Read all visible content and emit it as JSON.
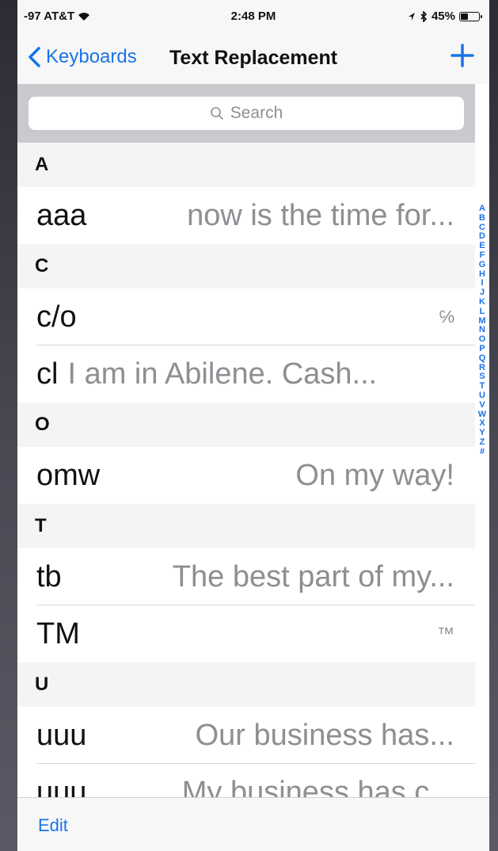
{
  "status_bar": {
    "carrier": "-97 AT&T",
    "time": "2:48 PM",
    "battery": "45%",
    "battery_level": 0.45
  },
  "nav": {
    "back_label": "Keyboards",
    "title": "Text Replacement"
  },
  "search": {
    "placeholder": "Search"
  },
  "sections": [
    {
      "letter": "A",
      "items": [
        {
          "shortcut": "aaa",
          "phrase": "now is the time for..."
        }
      ]
    },
    {
      "letter": "C",
      "items": [
        {
          "shortcut": "c/o",
          "phrase": "℅"
        },
        {
          "shortcut": "cl",
          "phrase": "I am in Abilene.  Cash..."
        }
      ]
    },
    {
      "letter": "O",
      "items": [
        {
          "shortcut": "omw",
          "phrase": "On my way!"
        }
      ]
    },
    {
      "letter": "T",
      "items": [
        {
          "shortcut": "tb",
          "phrase": "The best part of my..."
        },
        {
          "shortcut": "TM",
          "phrase": "™"
        }
      ]
    },
    {
      "letter": "U",
      "items": [
        {
          "shortcut": "uuu",
          "phrase": "Our business has..."
        },
        {
          "shortcut": "uuu",
          "phrase": "My business has c..."
        }
      ]
    }
  ],
  "index_letters": [
    "A",
    "B",
    "C",
    "D",
    "E",
    "F",
    "G",
    "H",
    "I",
    "J",
    "K",
    "L",
    "M",
    "N",
    "O",
    "P",
    "Q",
    "R",
    "S",
    "T",
    "U",
    "V",
    "W",
    "X",
    "Y",
    "Z",
    "#"
  ],
  "toolbar": {
    "edit_label": "Edit"
  },
  "colors": {
    "accent": "#1a73e8",
    "section_bg": "#f4f4f5",
    "search_bar_bg": "#c9c9ce"
  }
}
